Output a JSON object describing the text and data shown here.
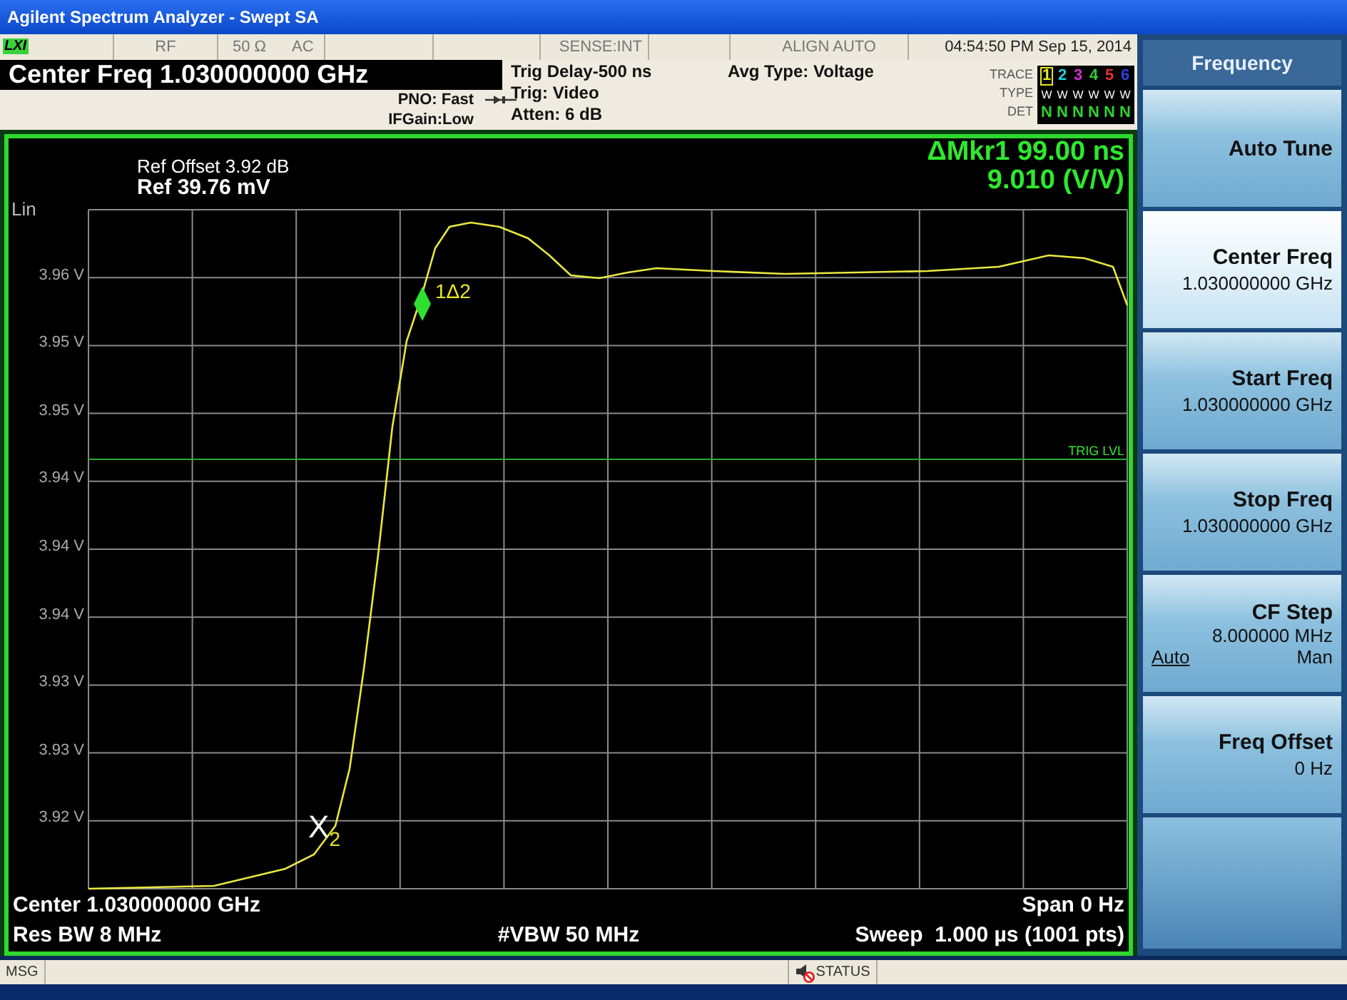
{
  "window": {
    "title": "Agilent Spectrum Analyzer - Swept SA"
  },
  "status_row": {
    "logo": "LXI",
    "input": "RF",
    "impedance": "50 Ω",
    "coupling": "AC",
    "sense": "SENSE:INT",
    "align": "ALIGN AUTO",
    "datetime": "04:54:50 PM Sep 15, 2014"
  },
  "header": {
    "center_freq": "Center Freq 1.030000000 GHz",
    "pno": "PNO: Fast",
    "if_gain": "IFGain:Low",
    "trigger_lines": [
      "Trig Delay-500 ns",
      "Trig: Video",
      "Atten: 6 dB"
    ],
    "avg_type": "Avg Type: Voltage",
    "row_labels": [
      "TRACE",
      "TYPE",
      "DET"
    ],
    "traces": [
      {
        "number": "1",
        "type": "W",
        "det": "N",
        "color": "#e8e820",
        "selected": true
      },
      {
        "number": "2",
        "type": "W",
        "det": "N",
        "color": "#20d0e0",
        "selected": false
      },
      {
        "number": "3",
        "type": "W",
        "det": "N",
        "color": "#d030d0",
        "selected": false
      },
      {
        "number": "4",
        "type": "W",
        "det": "N",
        "color": "#30d030",
        "selected": false
      },
      {
        "number": "5",
        "type": "W",
        "det": "N",
        "color": "#e03030",
        "selected": false
      },
      {
        "number": "6",
        "type": "W",
        "det": "N",
        "color": "#3040e8",
        "selected": false
      }
    ]
  },
  "graph": {
    "ref_offset": "Ref Offset 3.92 dB",
    "ref_level": "Ref 39.76 mV",
    "scale": "Lin",
    "marker_readout": [
      "ΔMkr1 99.00 ns",
      "9.010 (V/V)"
    ],
    "y_labels": [
      "3.96 V",
      "3.95 V",
      "3.95 V",
      "3.94 V",
      "3.94 V",
      "3.94 V",
      "3.93 V",
      "3.93 V",
      "3.92 V"
    ],
    "delta_marker_label": "1Δ2",
    "reference_marker": {
      "letter": "X",
      "index": "2"
    },
    "trigger_level_label": "TRIG LVL",
    "footer": {
      "center": "Center 1.030000000 GHz",
      "span": "Span 0 Hz",
      "res_bw": "Res BW 8 MHz",
      "vbw": "#VBW 50 MHz",
      "sweep": "Sweep  1.000 µs (1001 pts)"
    }
  },
  "softkeys": {
    "title": "Frequency",
    "keys": [
      {
        "kind": "action",
        "label": "Auto Tune",
        "selected": false
      },
      {
        "kind": "value",
        "label": "Center Freq",
        "value": "1.030000000 GHz",
        "selected": true
      },
      {
        "kind": "value",
        "label": "Start Freq",
        "value": "1.030000000 GHz",
        "selected": false
      },
      {
        "kind": "value",
        "label": "Stop Freq",
        "value": "1.030000000 GHz",
        "selected": false
      },
      {
        "kind": "toggle",
        "label": "CF Step",
        "value": "8.000000 MHz",
        "options": [
          {
            "label": "Auto",
            "selected": true
          },
          {
            "label": "Man",
            "selected": false
          }
        ],
        "selected": false
      },
      {
        "kind": "value",
        "label": "Freq Offset",
        "value": "0 Hz",
        "selected": false
      }
    ]
  },
  "message_bar": {
    "label": "MSG",
    "status": "STATUS"
  }
}
